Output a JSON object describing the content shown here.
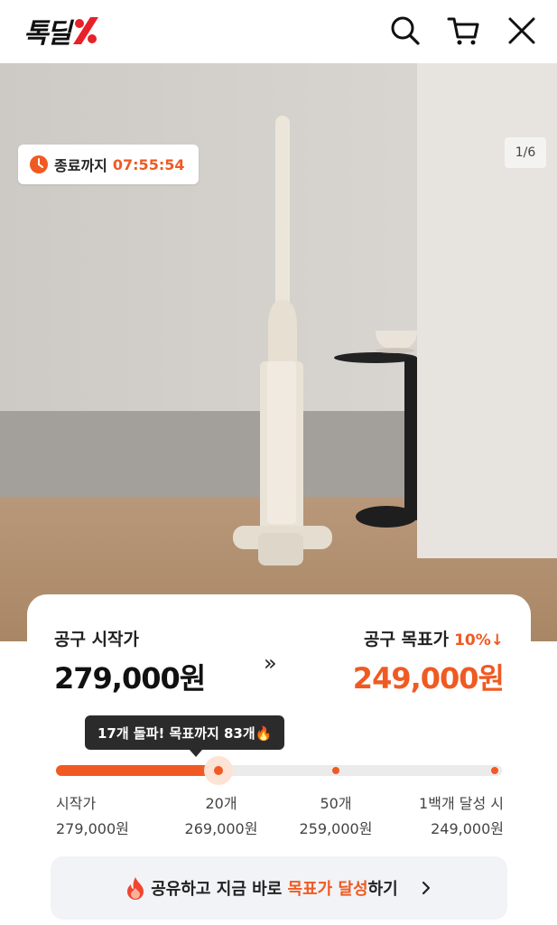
{
  "header": {
    "logo_text": "톡딜",
    "icons": [
      "search-icon",
      "cart-icon",
      "close-icon"
    ]
  },
  "hero": {
    "timer_label": "종료까지",
    "timer_value": "07:55:54",
    "image_counter": "1/6"
  },
  "pricing": {
    "start_label": "공구 시작가",
    "start_price": "279,000원",
    "arrows": "»",
    "target_label": "공구 목표가",
    "target_discount": "10%↓",
    "target_price": "249,000원"
  },
  "progress": {
    "tooltip": "17개 돌파! 목표까지 83개🔥",
    "current_fraction": 0.36,
    "milestones": [
      {
        "label": "시작가",
        "price": "279,000원"
      },
      {
        "label": "20개",
        "price": "269,000원"
      },
      {
        "label": "50개",
        "price": "259,000원"
      },
      {
        "label": "1백개 달성 시",
        "price": "249,000원"
      }
    ]
  },
  "share": {
    "icon": "fire-icon",
    "text_before": "공유하고 지금 바로 ",
    "text_highlight": "목표가 달성",
    "text_after": "하기"
  },
  "colors": {
    "accent": "#f05a22",
    "dark": "#2b2b2b",
    "track": "#ebebeb"
  }
}
